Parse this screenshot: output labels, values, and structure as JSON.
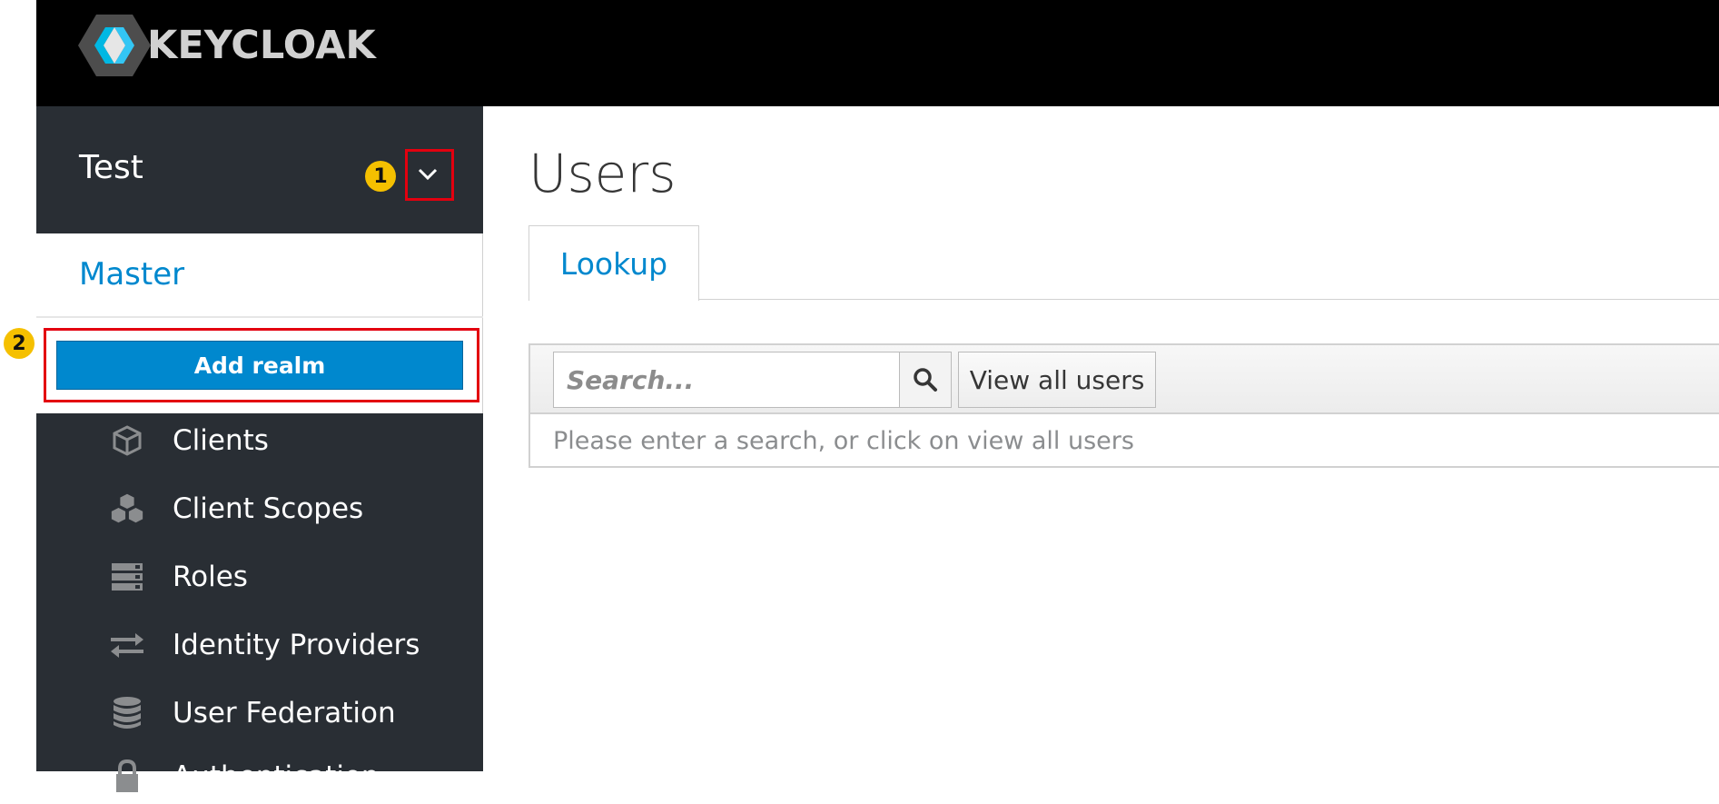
{
  "header": {
    "logo_text": "KEYCLOAK"
  },
  "sidebar": {
    "current_realm": "Test",
    "realm_menu": {
      "items": [
        {
          "label": "Master"
        }
      ],
      "add_realm_label": "Add realm"
    },
    "nav_items": [
      {
        "label": "Clients",
        "icon": "cube-icon"
      },
      {
        "label": "Client Scopes",
        "icon": "cubes-icon"
      },
      {
        "label": "Roles",
        "icon": "server-stack-icon"
      },
      {
        "label": "Identity Providers",
        "icon": "exchange-arrows-icon"
      },
      {
        "label": "User Federation",
        "icon": "database-icon"
      },
      {
        "label": "Authentication",
        "icon": "lock-icon"
      }
    ]
  },
  "annotations": {
    "marker_1": "1",
    "marker_2": "2"
  },
  "main": {
    "title": "Users",
    "tabs": [
      {
        "label": "Lookup",
        "active": true
      }
    ],
    "search": {
      "placeholder": "Search...",
      "value": ""
    },
    "view_all_label": "View all users",
    "hint": "Please enter a search, or click on view all users"
  },
  "colors": {
    "accent": "#0088ce",
    "sidebar_bg": "#292e34",
    "highlight_red": "#e3000f",
    "badge_yellow": "#f5c000"
  }
}
